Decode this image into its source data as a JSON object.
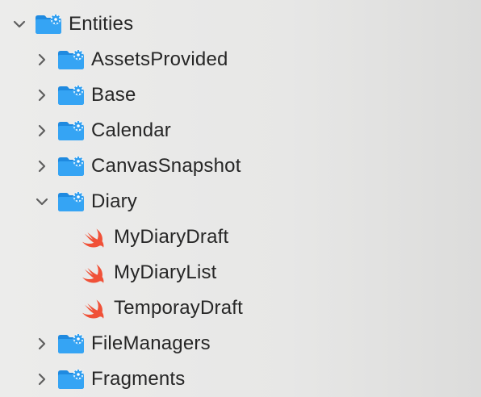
{
  "navigator": {
    "root": {
      "label": "Entities",
      "expanded": true,
      "icon": "folder-gear-icon"
    },
    "children": [
      {
        "label": "AssetsProvided",
        "expanded": false,
        "icon": "folder-gear-icon"
      },
      {
        "label": "Base",
        "expanded": false,
        "icon": "folder-gear-icon"
      },
      {
        "label": "Calendar",
        "expanded": false,
        "icon": "folder-gear-icon"
      },
      {
        "label": "CanvasSnapshot",
        "expanded": false,
        "icon": "folder-gear-icon"
      },
      {
        "label": "Diary",
        "expanded": true,
        "icon": "folder-gear-icon",
        "files": [
          {
            "label": "MyDiaryDraft",
            "icon": "swift-file-icon"
          },
          {
            "label": "MyDiaryList",
            "icon": "swift-file-icon"
          },
          {
            "label": "TemporayDraft",
            "icon": "swift-file-icon"
          }
        ]
      },
      {
        "label": "FileManagers",
        "expanded": false,
        "icon": "folder-gear-icon"
      },
      {
        "label": "Fragments",
        "expanded": false,
        "icon": "folder-gear-icon"
      }
    ]
  },
  "colors": {
    "folder_blue": "#2f9ef0",
    "folder_blue_dark": "#1f8ae0",
    "swift_orange": "#f05138",
    "text": "#262626",
    "chevron": "#6e6e6e"
  }
}
